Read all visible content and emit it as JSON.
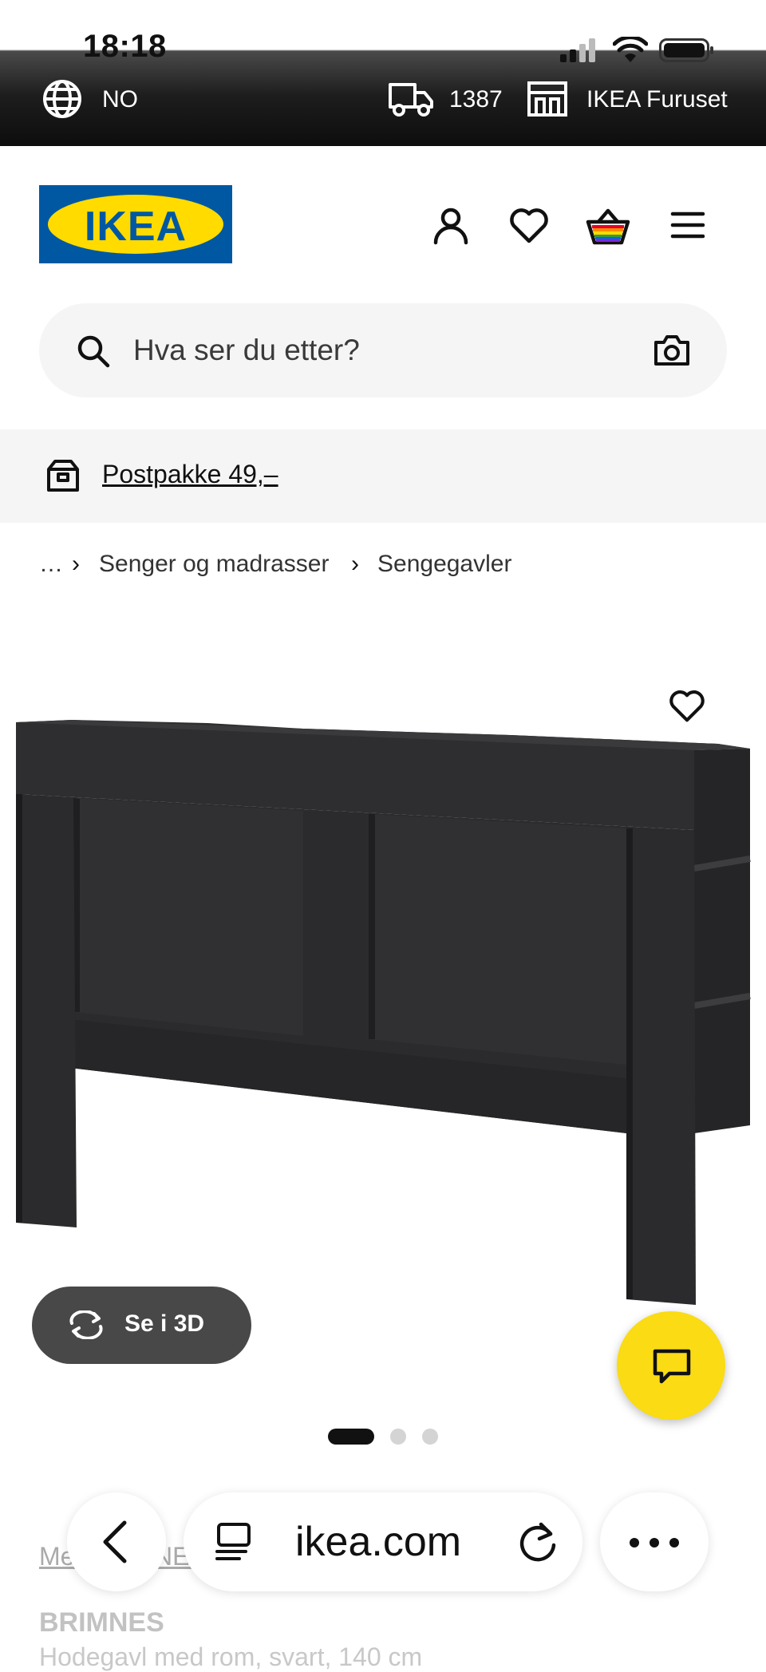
{
  "status_bar": {
    "time": "18:18"
  },
  "top_bar": {
    "language": "NO",
    "postcode": "1387",
    "store": "IKEA Furuset"
  },
  "header": {
    "logo_text": "IKEA"
  },
  "search": {
    "placeholder": "Hva ser du etter?"
  },
  "promo": {
    "text": "Postpakke 49,–"
  },
  "breadcrumb": {
    "items": [
      "…",
      "Senger og madrasser",
      "Sengegavler"
    ]
  },
  "product": {
    "view_3d_label": "Se i 3D",
    "image_count": 3,
    "active_image": 1,
    "series_link": "Mer BRIMNES",
    "name": "BRIMNES",
    "description": "Hodegavl med rom, svart, 140 cm"
  },
  "browser": {
    "url": "ikea.com"
  },
  "colors": {
    "ikea_blue": "#0058a3",
    "ikea_yellow": "#ffdb00",
    "chat_yellow": "#fadb14",
    "headboard": "#2e2e30"
  }
}
